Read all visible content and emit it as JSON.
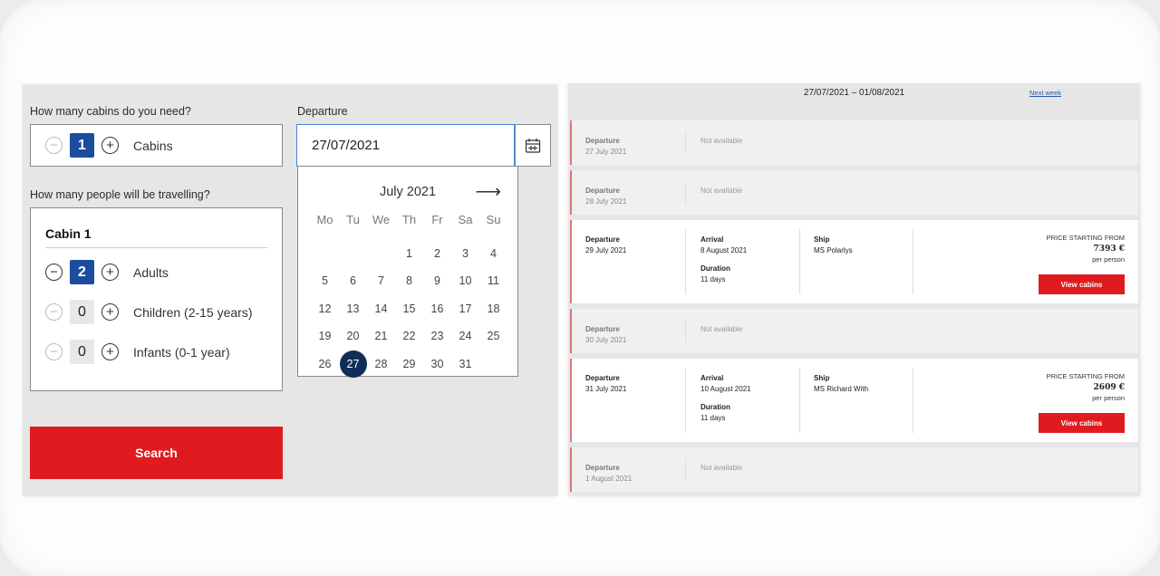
{
  "search_form": {
    "cabins_question": "How many cabins do you need?",
    "cabins_value": "1",
    "cabins_label": "Cabins",
    "people_question": "How many people will be travelling?",
    "cabin_title": "Cabin 1",
    "travellers": [
      {
        "label": "Adults",
        "value": "2",
        "minus_enabled": true
      },
      {
        "label": "Children (2-15 years)",
        "value": "0",
        "minus_enabled": false
      },
      {
        "label": "Infants (0-1 year)",
        "value": "0",
        "minus_enabled": false
      }
    ],
    "departure_label": "Departure",
    "departure_value": "27/07/2021",
    "search_label": "Search"
  },
  "calendar": {
    "month_label": "July 2021",
    "weekdays": [
      "Mo",
      "Tu",
      "We",
      "Th",
      "Fr",
      "Sa",
      "Su"
    ],
    "days": [
      "",
      "",
      "",
      "1",
      "2",
      "3",
      "4",
      "5",
      "6",
      "7",
      "8",
      "9",
      "10",
      "11",
      "12",
      "13",
      "14",
      "15",
      "16",
      "17",
      "18",
      "19",
      "20",
      "21",
      "22",
      "23",
      "24",
      "25",
      "26",
      "27",
      "28",
      "29",
      "30",
      "31"
    ],
    "selected_day": "27"
  },
  "results": {
    "date_range": "27/07/2021 – 01/08/2021",
    "next_week_label": "Next week",
    "labels": {
      "departure": "Departure",
      "arrival": "Arrival",
      "duration": "Duration",
      "ship": "Ship",
      "not_available": "Not available",
      "price_from": "PRICE STARTING FROM",
      "per_person": "per person",
      "view_cabins": "View cabins"
    },
    "rows": [
      {
        "departure": "27 July 2021",
        "available": false
      },
      {
        "departure": "28 July 2021",
        "available": false
      },
      {
        "departure": "29 July 2021",
        "available": true,
        "arrival": "8 August 2021",
        "duration": "11 days",
        "ship": "MS Polarlys",
        "price": "7393 €"
      },
      {
        "departure": "30 July 2021",
        "available": false
      },
      {
        "departure": "31 July 2021",
        "available": true,
        "arrival": "10 August 2021",
        "duration": "11 days",
        "ship": "MS Richard With",
        "price": "2609 €"
      },
      {
        "departure": "1 August 2021",
        "available": false
      }
    ]
  },
  "colors": {
    "accent_red": "#e01b1f",
    "stepper_blue": "#1b4d9c",
    "selected_day": "#0f2e57",
    "focus_border": "#4a86d8"
  }
}
